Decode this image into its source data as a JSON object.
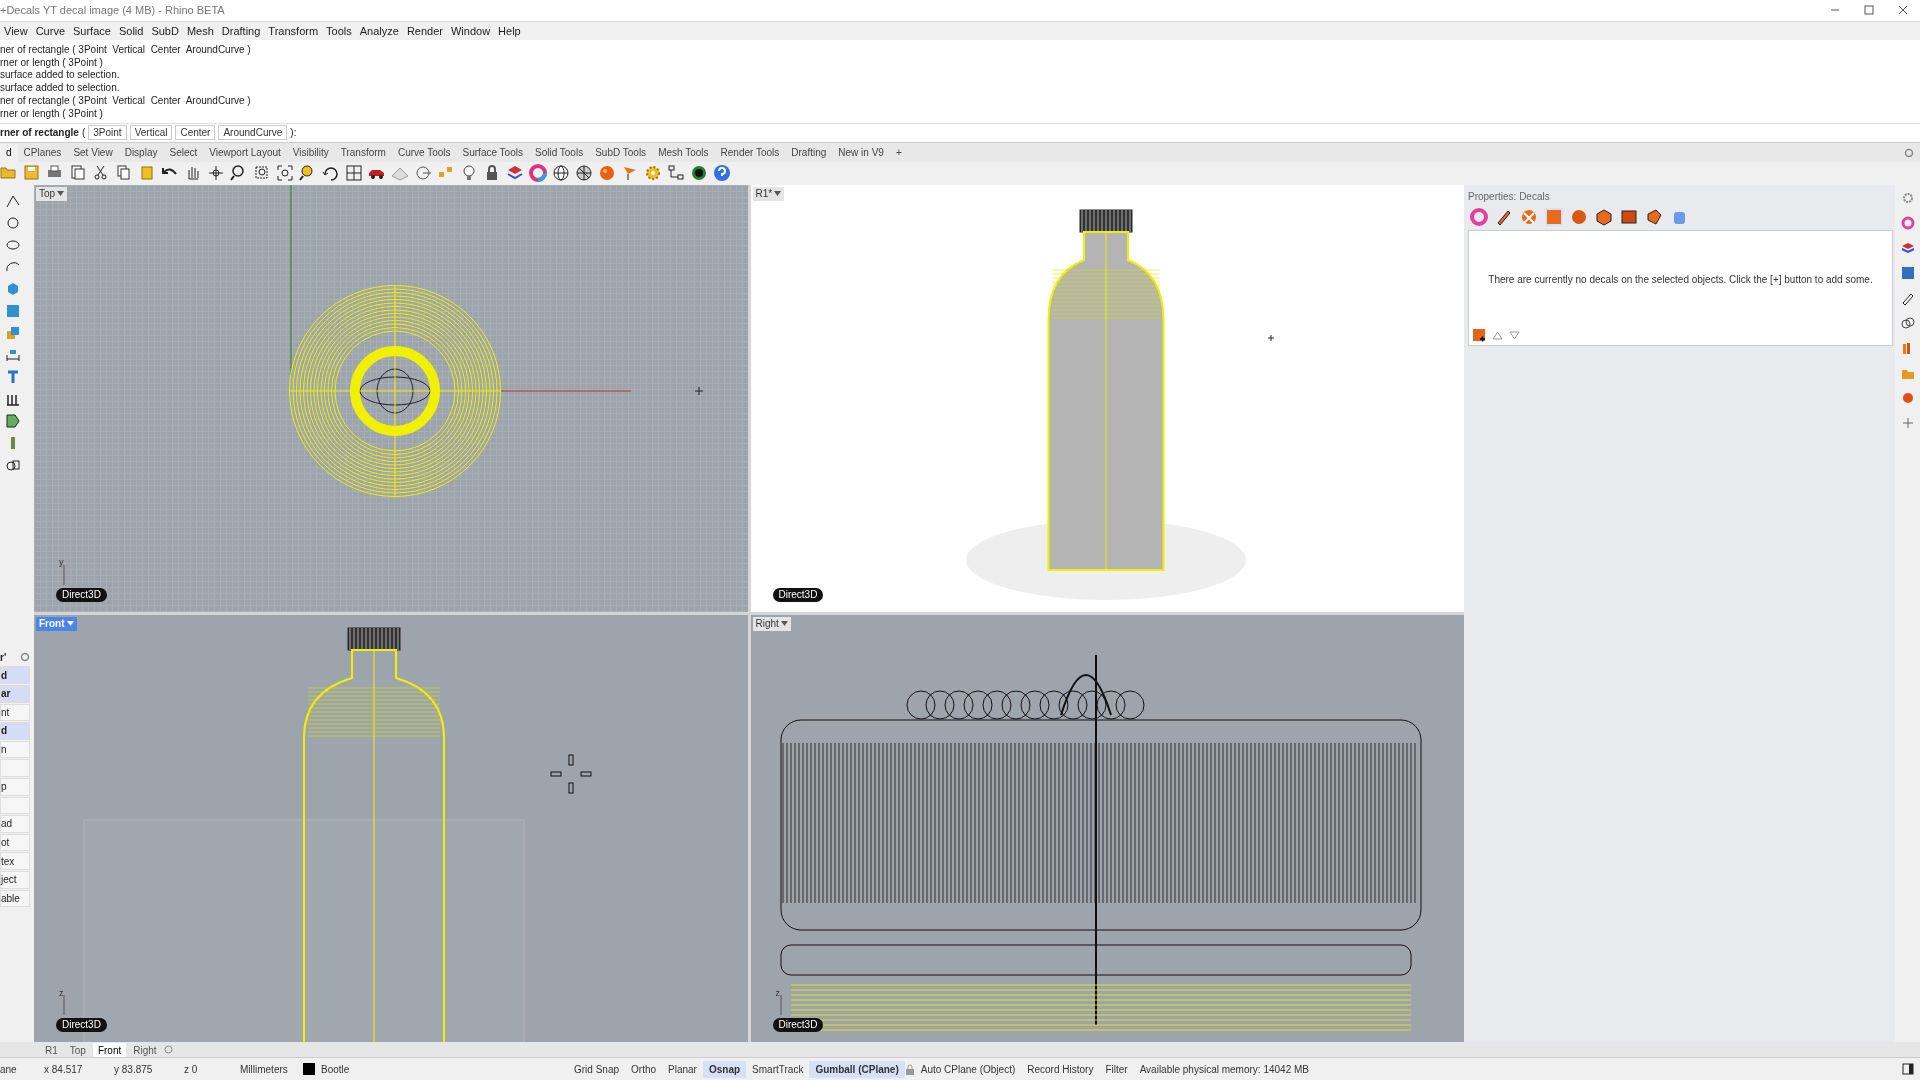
{
  "window": {
    "title": "+Decals YT decal image (4 MB) - Rhino BETA"
  },
  "menu": [
    "View",
    "Curve",
    "Surface",
    "Solid",
    "SubD",
    "Mesh",
    "Drafting",
    "Transform",
    "Tools",
    "Analyze",
    "Render",
    "Window",
    "Help"
  ],
  "command_history": [
    "ner of rectangle ( 3Point  Vertical  Center  AroundCurve )",
    "rner or length ( 3Point )",
    "surface added to selection.",
    "surface added to selection.",
    "ner of rectangle ( 3Point  Vertical  Center  AroundCurve )",
    "rner or length ( 3Point )"
  ],
  "command_prompt": {
    "label": "rner of rectangle",
    "open": "(",
    "options": [
      "3Point",
      "Vertical",
      "Center",
      "AroundCurve"
    ],
    "close": "):"
  },
  "toolbar_tabs": [
    {
      "label": "d",
      "selected": true
    },
    {
      "label": "CPlanes",
      "selected": false
    },
    {
      "label": "Set View",
      "selected": false
    },
    {
      "label": "Display",
      "selected": false
    },
    {
      "label": "Select",
      "selected": false
    },
    {
      "label": "Viewport Layout",
      "selected": false
    },
    {
      "label": "Visibility",
      "selected": false
    },
    {
      "label": "Transform",
      "selected": false
    },
    {
      "label": "Curve Tools",
      "selected": false
    },
    {
      "label": "Surface Tools",
      "selected": false
    },
    {
      "label": "Solid Tools",
      "selected": false
    },
    {
      "label": "SubD Tools",
      "selected": false
    },
    {
      "label": "Mesh Tools",
      "selected": false
    },
    {
      "label": "Render Tools",
      "selected": false
    },
    {
      "label": "Drafting",
      "selected": false
    },
    {
      "label": "New in V9",
      "selected": false
    },
    {
      "label": "+",
      "selected": false
    }
  ],
  "viewports": [
    {
      "title": "Top",
      "kind": "top",
      "selected": false,
      "display": "Direct3D",
      "axis": "y"
    },
    {
      "title": "R1*",
      "kind": "render",
      "selected": false,
      "display": "Direct3D"
    },
    {
      "title": "Front",
      "kind": "front",
      "selected": true,
      "display": "Direct3D",
      "axis": "z"
    },
    {
      "title": "Right",
      "kind": "right",
      "selected": false,
      "display": "Direct3D",
      "axis": "z"
    }
  ],
  "left_panel": {
    "header": "r'",
    "buttons": [
      {
        "label": "d",
        "selected": true
      },
      {
        "label": "ar",
        "selected": true
      },
      {
        "label": "nt",
        "selected": false
      },
      {
        "label": "d",
        "selected": true
      },
      {
        "label": "n",
        "selected": false
      },
      {
        "label": "p",
        "selected": false
      },
      {
        "label": "ad",
        "selected": false
      },
      {
        "label": "ot",
        "selected": false
      },
      {
        "label": "tex",
        "selected": false
      },
      {
        "label": "ject",
        "selected": false
      },
      {
        "label": "able",
        "selected": false
      }
    ]
  },
  "properties": {
    "title": "Properties: Decals",
    "message": "There are currently no decals on the selected objects. Click the [+] button to add some."
  },
  "viewport_tabs": [
    {
      "label": "R1",
      "selected": false
    },
    {
      "label": "Top",
      "selected": false
    },
    {
      "label": "Front",
      "selected": true
    },
    {
      "label": "Right",
      "selected": false
    }
  ],
  "status_bar": {
    "cplane": "ane",
    "x": "x 84.517",
    "y": "y 83.875",
    "z": "z 0",
    "units": "Millimeters",
    "layer": {
      "name": "Bootle",
      "color": "#000000"
    },
    "toggles": [
      {
        "label": "Grid Snap",
        "on": false
      },
      {
        "label": "Ortho",
        "on": false
      },
      {
        "label": "Planar",
        "on": false
      },
      {
        "label": "Osnap",
        "on": true
      },
      {
        "label": "SmartTrack",
        "on": false
      },
      {
        "label": "Gumball (CPlane)",
        "on": true
      },
      {
        "label": "Auto CPlane (Object)",
        "on": false,
        "locked": true
      },
      {
        "label": "Record History",
        "on": false
      },
      {
        "label": "Filter",
        "on": false
      }
    ],
    "memory": "Available physical memory: 14042 MB"
  }
}
